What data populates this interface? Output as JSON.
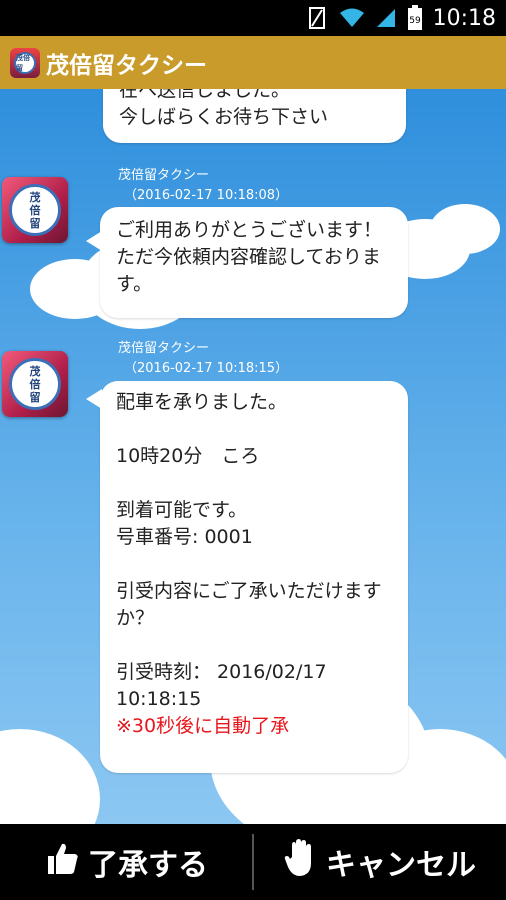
{
  "status_bar": {
    "time": "10:18",
    "battery_level": "59"
  },
  "action_bar": {
    "title": "茂倍留タクシー",
    "logo_text": "茂倍留"
  },
  "messages": [
    {
      "lines": [
        "在へ送信しました。",
        "今しばらくお待ち下さい"
      ]
    },
    {
      "sender": "茂倍留タクシー",
      "timestamp": "（2016-02-17 10:18:08）",
      "lines": [
        "ご利用ありがとうございます！",
        "ただ今依頼内容確認しておりま",
        "す。"
      ]
    },
    {
      "sender": "茂倍留タクシー",
      "timestamp": "（2016-02-17 10:18:15）",
      "lines": [
        "配車を承りました。",
        "",
        "10時20分　ころ",
        "",
        "到着可能です。",
        "号車番号: 0001",
        "",
        "引受内容にご了承いただけます",
        "か？",
        "",
        "引受時刻： 2016/02/17",
        "10:18:15"
      ],
      "notice": "※30秒後に自動了承"
    }
  ],
  "avatar": {
    "line1": "茂",
    "line2": "倍",
    "line3": "留"
  },
  "bottom_bar": {
    "accept_label": "了承する",
    "cancel_label": "キャンセル"
  },
  "colors": {
    "action_bar": "#c89b2a",
    "sky": "#2f8fdc",
    "notice": "#e8161c"
  }
}
